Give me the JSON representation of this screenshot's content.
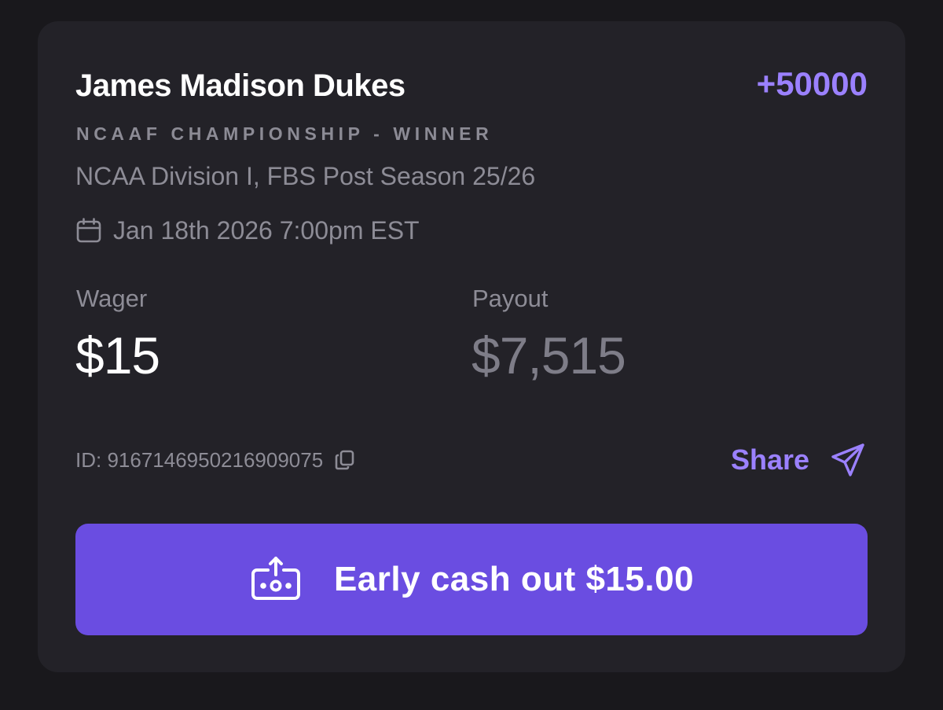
{
  "bet": {
    "team": "James Madison Dukes",
    "odds": "+50000",
    "market": "NCAAF CHAMPIONSHIP - WINNER",
    "league": "NCAA Division I, FBS Post Season 25/26",
    "datetime": "Jan 18th 2026 7:00pm EST",
    "wager_label": "Wager",
    "wager_value": "$15",
    "payout_label": "Payout",
    "payout_value": "$7,515",
    "id_text": "ID: 9167146950216909075",
    "share_label": "Share",
    "cashout_label": "Early cash out $15.00"
  },
  "icons": {
    "calendar": "calendar-icon",
    "copy": "copy-icon",
    "share": "send-icon",
    "cashout": "cash-out-icon"
  },
  "colors": {
    "background": "#19181c",
    "card": "#232228",
    "accent": "#9b81ff",
    "button": "#6a4de1",
    "muted_text": "#8d8c96",
    "primary_text": "#ffffff"
  }
}
